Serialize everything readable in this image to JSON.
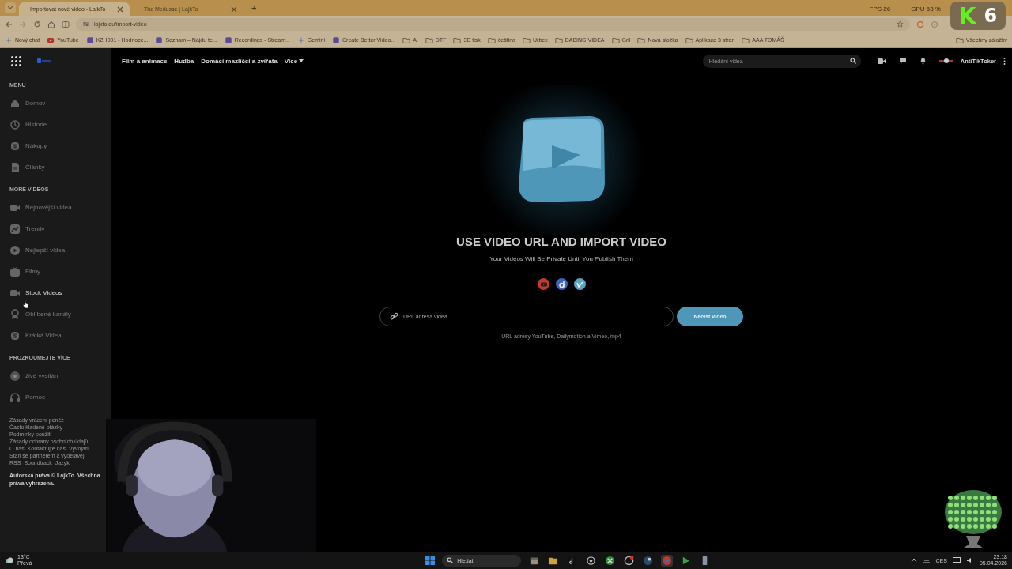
{
  "browser": {
    "tabs": [
      {
        "title": "Importovat nové video - LajkTo",
        "selected": true
      },
      {
        "title": "The Medusse | LajkTo",
        "selected": false
      }
    ],
    "new_tab": "+",
    "address": "lajkto.eu/import-video",
    "bookmarks": [
      {
        "label": "Nový chat",
        "kind": "spark"
      },
      {
        "label": "YouTube",
        "kind": "youtube"
      },
      {
        "label": "KZH001 - Hodnoce...",
        "kind": "site"
      },
      {
        "label": "Seznam – Najdu te...",
        "kind": "site"
      },
      {
        "label": "Recordings - Stream...",
        "kind": "site"
      },
      {
        "label": "Gemini",
        "kind": "spark"
      },
      {
        "label": "Create Better Video...",
        "kind": "site"
      },
      {
        "label": "AI",
        "kind": "folder"
      },
      {
        "label": "DTF",
        "kind": "folder"
      },
      {
        "label": "3D tisk",
        "kind": "folder"
      },
      {
        "label": "čeština",
        "kind": "folder"
      },
      {
        "label": "Urbex",
        "kind": "folder"
      },
      {
        "label": "DABING VIDEA",
        "kind": "folder"
      },
      {
        "label": "Gril",
        "kind": "folder"
      },
      {
        "label": "Nová složka",
        "kind": "folder"
      },
      {
        "label": "Aplikace 3 stran",
        "kind": "folder"
      },
      {
        "label": "AAA TOMÁŠ",
        "kind": "folder"
      }
    ],
    "all_bookmarks": "Všechny záložky"
  },
  "overlay": {
    "stats": [
      "FPS 26",
      "GPU 53 %"
    ],
    "badge_letter": "K",
    "badge_number": "6"
  },
  "site": {
    "nav": [
      "Film a animace",
      "Hudba",
      "Domácí mazlíčci a zvířata"
    ],
    "more": "Více",
    "search": {
      "placeholder": "Hledání videa"
    },
    "user": "AntiTikToker"
  },
  "sidebar": {
    "sections": [
      {
        "title": "MENU",
        "items": [
          {
            "label": "Domov",
            "kind": "home",
            "highlighted": false
          },
          {
            "label": "Historie",
            "kind": "history",
            "highlighted": false
          },
          {
            "label": "Nákupy",
            "kind": "coin",
            "highlighted": false
          },
          {
            "label": "Články",
            "kind": "doc",
            "highlighted": false
          }
        ]
      },
      {
        "title": "MORE VIDEOS",
        "items": [
          {
            "label": "Nejnovější videa",
            "kind": "camera",
            "highlighted": false
          },
          {
            "label": "Trendy",
            "kind": "trend",
            "highlighted": false
          },
          {
            "label": "Nejlepší videa",
            "kind": "play",
            "highlighted": false
          },
          {
            "label": "Filmy",
            "kind": "tv",
            "highlighted": false
          },
          {
            "label": "Stock Videos",
            "kind": "camera",
            "highlighted": true
          },
          {
            "label": "Oblíbené kanály",
            "kind": "award",
            "highlighted": false
          },
          {
            "label": "Krátká Videa",
            "kind": "coin",
            "highlighted": false
          }
        ]
      },
      {
        "title": "PROZKOUMEJTE VÍCE",
        "items": [
          {
            "label": "živé vysílání",
            "kind": "live",
            "highlighted": false
          },
          {
            "label": "Pomoc",
            "kind": "headset",
            "highlighted": false
          }
        ]
      }
    ],
    "footer_links": [
      [
        "Zásady vrácení peněz"
      ],
      [
        "Často kladené otázky"
      ],
      [
        "Podmínky použití"
      ],
      [
        "Zásady ochrany osobních údajů"
      ],
      [
        "O nás",
        "Kontaktujte nás",
        "Vývojáři"
      ],
      [
        "Staň se partnerem a vydělávej"
      ],
      [
        "RSS",
        "Soundtrack",
        "Jazyk"
      ]
    ],
    "copyright": "Autorská práva © LajkTo. Všechna práva vyhrazena."
  },
  "main": {
    "title": "USE VIDEO URL AND IMPORT VIDEO",
    "subtitle": "Your Videos Will Be Private Until You Publish Them",
    "sources": [
      {
        "kind": "youtube",
        "color": "#c0392b"
      },
      {
        "kind": "dailymotion",
        "color": "#3e63c0"
      },
      {
        "kind": "vimeo",
        "color": "#59a6c6"
      }
    ],
    "url_field": {
      "placeholder": "URL adresa videa"
    },
    "button": "Načíst video",
    "hint": "URL adresy YouTube, Dailymotion a Vimeo, mp4"
  },
  "taskbar": {
    "weather": {
      "temp": "13°C",
      "text": "Převá"
    },
    "search": {
      "placeholder": "Hledat"
    },
    "apps": [
      {
        "kind": "files",
        "active": false
      },
      {
        "kind": "folder",
        "active": false
      },
      {
        "kind": "note",
        "active": false
      },
      {
        "kind": "gear",
        "active": false
      },
      {
        "kind": "xbox",
        "active": false
      },
      {
        "kind": "red",
        "active": false
      },
      {
        "kind": "steam",
        "active": false
      },
      {
        "kind": "browser",
        "active": true
      },
      {
        "kind": "play",
        "active": false
      },
      {
        "kind": "tool",
        "active": false
      }
    ],
    "language": "CES",
    "time": "23:18",
    "date": "05.04.2026"
  }
}
